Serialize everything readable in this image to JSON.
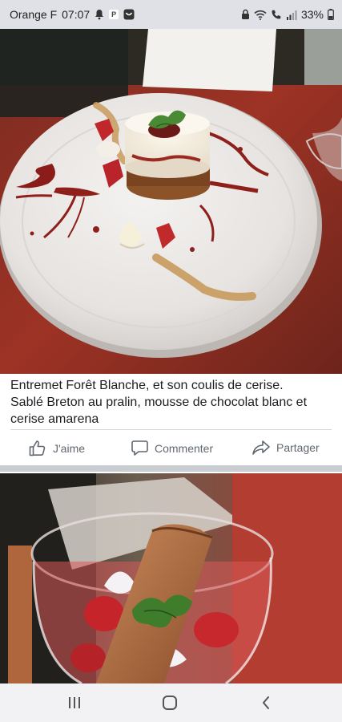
{
  "status_bar": {
    "carrier": "Orange F",
    "time": "07:07",
    "battery": "33%",
    "icons_left": [
      "notification-bell-icon",
      "p-badge-icon",
      "app-icon"
    ],
    "icons_right": [
      "lock-icon",
      "wifi-icon",
      "call-signal-icon",
      "signal-bars-icon",
      "battery-icon"
    ]
  },
  "post": {
    "photo_1": {
      "name": "dessert-plate-photo"
    },
    "caption_lines": [
      "Entremet Forêt Blanche, et son coulis de cerise.",
      "Sablé Breton au pralin, mousse de chocolat blanc et",
      "cerise amarena"
    ],
    "actions": {
      "like": "J'aime",
      "comment": "Commenter",
      "share": "Partager"
    },
    "photo_2": {
      "name": "dessert-glass-photo"
    }
  },
  "nav_bar": {
    "items": [
      "recent-apps-icon",
      "home-icon",
      "back-icon"
    ]
  },
  "colors": {
    "status_bg": "#dfe1e6",
    "text": "#1c1e21",
    "action_text": "#606770",
    "separator": "#c9ccd1",
    "nav_bg": "#f2f2f4"
  }
}
